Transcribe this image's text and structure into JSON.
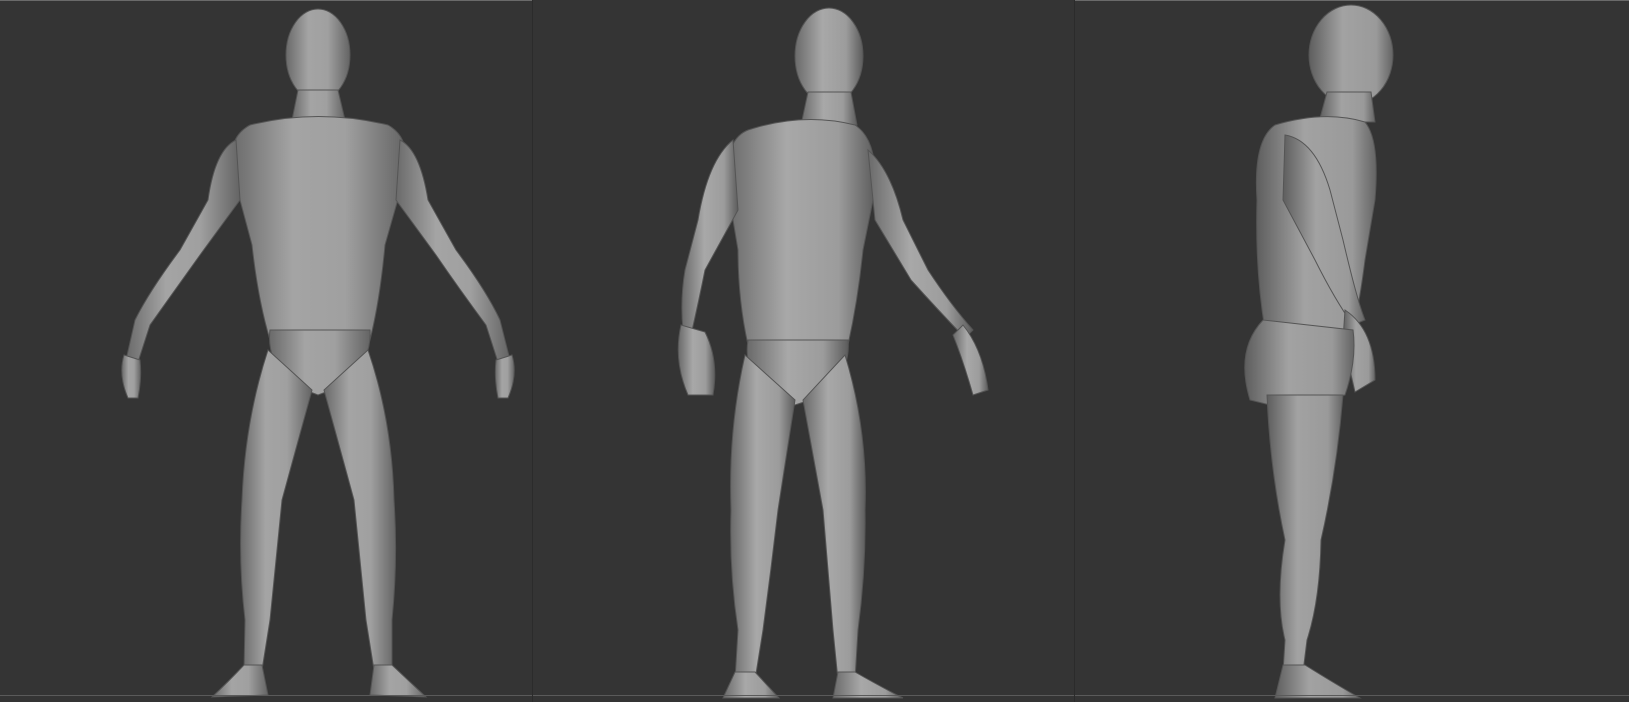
{
  "views": [
    {
      "id": "front-view",
      "figure": "front"
    },
    {
      "id": "three-quarter-view",
      "figure": "three-quarter"
    },
    {
      "id": "side-view",
      "figure": "side"
    }
  ],
  "colors": {
    "background": "#2b2b2b",
    "viewport": "#343434",
    "skin_light": "#a8a8a8",
    "skin_mid": "#8c8c8c",
    "skin_dark": "#5e5e5e"
  }
}
